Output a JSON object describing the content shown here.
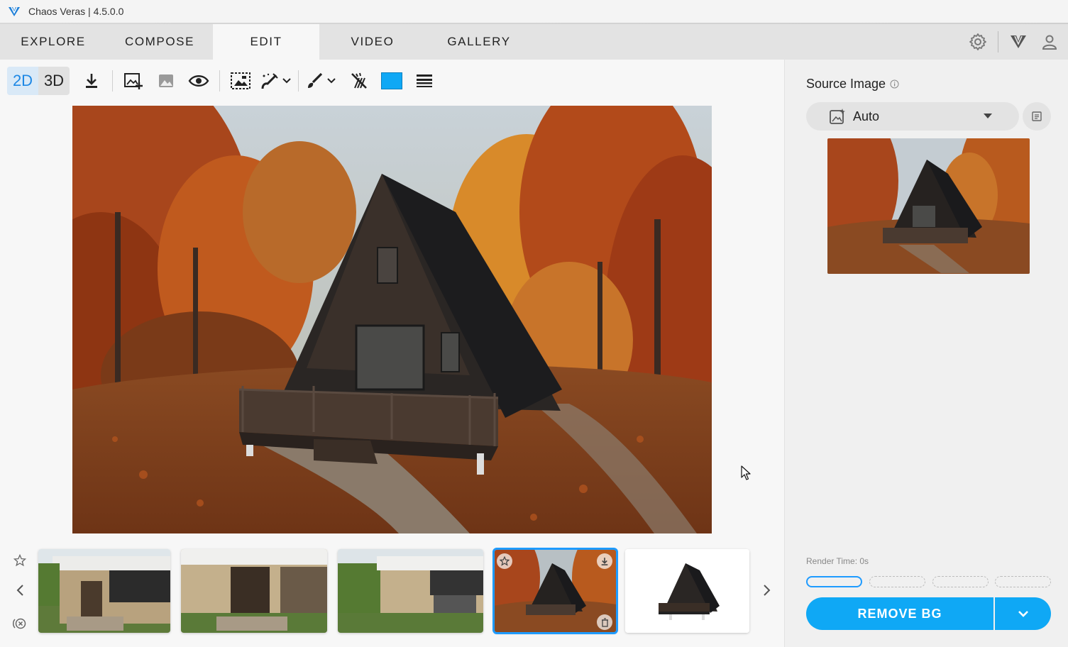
{
  "window": {
    "title": "Chaos Veras | 4.5.0.0",
    "logo_icon": "chaos-veras-logo-icon"
  },
  "nav": {
    "tabs": [
      {
        "label": "EXPLORE",
        "active": false
      },
      {
        "label": "COMPOSE",
        "active": false
      },
      {
        "label": "EDIT",
        "active": true
      },
      {
        "label": "VIDEO",
        "active": false
      },
      {
        "label": "GALLERY",
        "active": false
      }
    ],
    "right_icons": [
      "gear-icon",
      "veras-logo-icon",
      "user-icon"
    ]
  },
  "toolbar": {
    "mode_2d": "2D",
    "mode_3d": "3D",
    "active_mode": "2D",
    "tools": [
      "download-icon",
      "add-image-icon",
      "image-icon",
      "eye-icon",
      "select-region-icon",
      "magic-brush-icon",
      "brush-icon",
      "no-mask-icon",
      "color-swatch",
      "lines-icon"
    ],
    "swatch_color": "#0fa8f5"
  },
  "thumbnails": {
    "count": 5,
    "selected_index": 3
  },
  "panel": {
    "source_image_label": "Source Image",
    "source_select_value": "Auto",
    "render_time": "Render Time: 0s",
    "progress_steps": 4,
    "progress_active": 1,
    "remove_bg_label": "REMOVE BG"
  },
  "colors": {
    "accent": "#0fa8f5",
    "selection": "#1e9bff"
  }
}
